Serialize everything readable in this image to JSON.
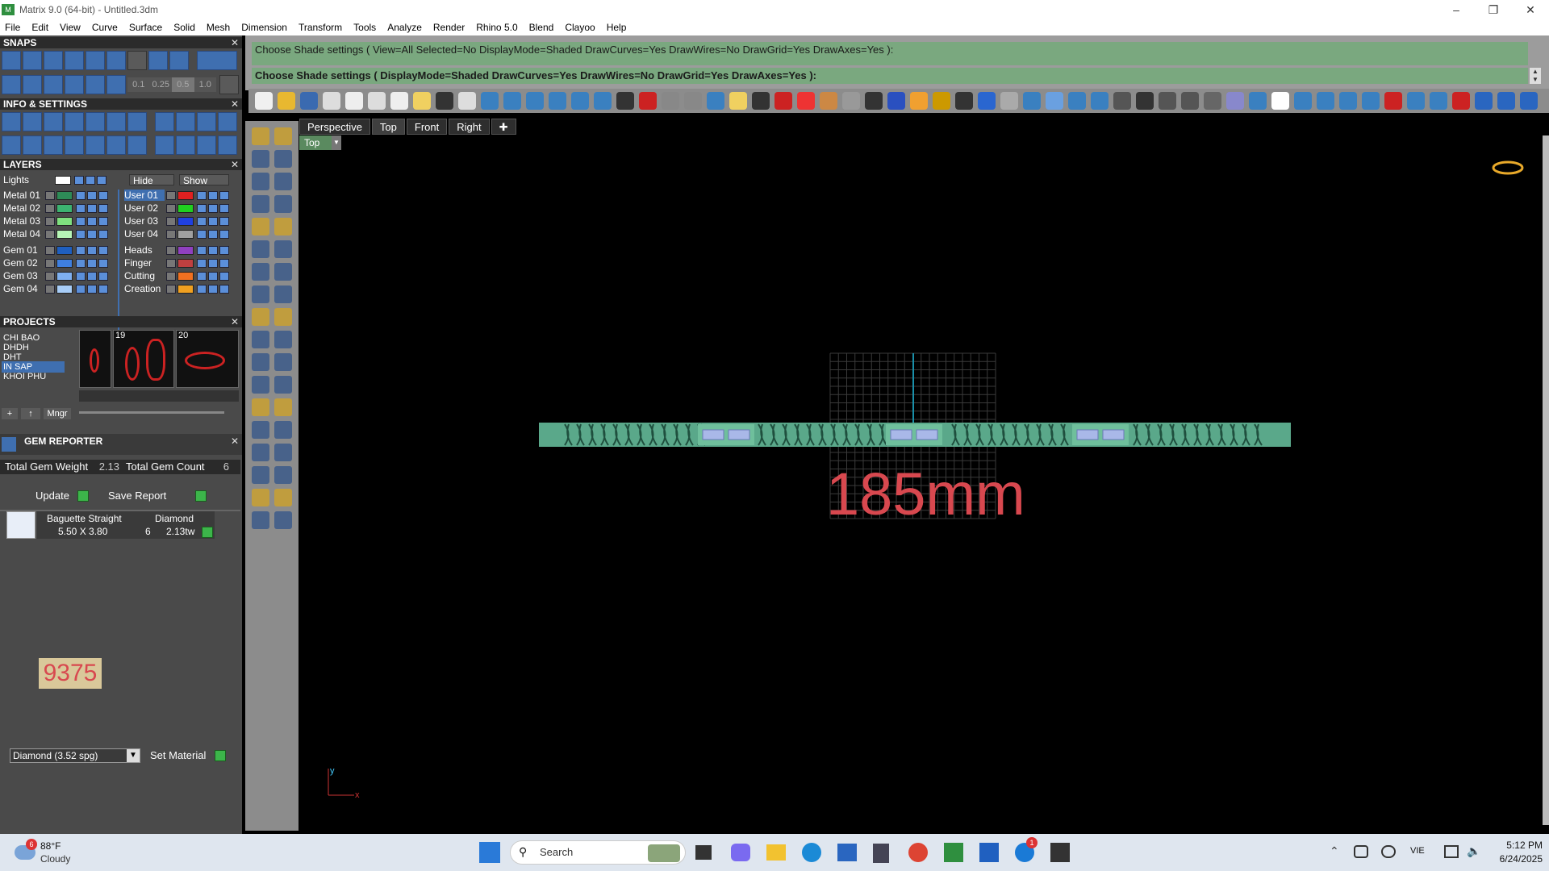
{
  "window": {
    "title": "Matrix 9.0 (64-bit) - Untitled.3dm",
    "app_icon": "matrix-logo-icon"
  },
  "menu": [
    "File",
    "Edit",
    "View",
    "Curve",
    "Surface",
    "Solid",
    "Mesh",
    "Dimension",
    "Transform",
    "Tools",
    "Analyze",
    "Render",
    "Rhino 5.0",
    "Blend",
    "Clayoo",
    "Help"
  ],
  "panels": {
    "snaps": {
      "title": "SNAPS",
      "values": [
        "0.1",
        "0.25",
        "0.5",
        "1.0"
      ]
    },
    "info": {
      "title": "INFO & SETTINGS"
    },
    "layers": {
      "title": "LAYERS",
      "lights_label": "Lights",
      "hide_label": "Hide",
      "show_label": "Show",
      "left": [
        {
          "name": "Metal 01",
          "color": "#2e8b57"
        },
        {
          "name": "Metal 02",
          "color": "#3cb371"
        },
        {
          "name": "Metal 03",
          "color": "#7fe07f"
        },
        {
          "name": "Metal 04",
          "color": "#b6f5b6"
        },
        {
          "name": "Gem 01",
          "color": "#1f5fbf"
        },
        {
          "name": "Gem 02",
          "color": "#3f7fdf"
        },
        {
          "name": "Gem 03",
          "color": "#7fb0f0"
        },
        {
          "name": "Gem 04",
          "color": "#a8cdf7"
        }
      ],
      "right": [
        {
          "name": "User 01",
          "color": "#e02020",
          "selected": true
        },
        {
          "name": "User 02",
          "color": "#20d020"
        },
        {
          "name": "User 03",
          "color": "#2040e0"
        },
        {
          "name": "User 04",
          "color": "#a0a0a0"
        },
        {
          "name": "Heads",
          "color": "#9040c0"
        },
        {
          "name": "Finger",
          "color": "#c04040"
        },
        {
          "name": "Cutting",
          "color": "#f07020"
        },
        {
          "name": "Creation",
          "color": "#f0a020"
        }
      ]
    },
    "projects": {
      "title": "PROJECTS",
      "items": [
        "CHI BAO",
        "DHDH",
        "DHT",
        "IN SAP",
        "KHOI PHU"
      ],
      "selected": "IN SAP",
      "thumb_numbers": [
        "19",
        "20"
      ],
      "mngr_label": "Mngr"
    },
    "gem_reporter": {
      "title": "GEM REPORTER",
      "total_weight_label": "Total Gem Weight",
      "total_weight": "2.13",
      "total_count_label": "Total Gem Count",
      "total_count": "6",
      "update_label": "Update",
      "save_label": "Save Report",
      "row": {
        "shape": "Baguette Straight",
        "material": "Diamond",
        "size": "5.50 X 3.80",
        "count": "6",
        "weight": "2.13tw"
      },
      "sticker": "9375",
      "material_select": "Diamond     (3.52 spg)",
      "set_material_label": "Set Material"
    }
  },
  "command": {
    "line1": "Choose Shade settings ( View=All  Selected=No  DisplayMode=Shaded  DrawCurves=Yes  DrawWires=No  DrawGrid=Yes  DrawAxes=Yes ):",
    "line2": "Choose Shade settings ( DisplayMode=Shaded  DrawCurves=Yes  DrawWires=No  DrawGrid=Yes  DrawAxes=Yes ):"
  },
  "viewport": {
    "tabs": [
      "Perspective",
      "Top",
      "Front",
      "Right"
    ],
    "active_tab": "Top",
    "label": "Top",
    "dimension_text": "185mm",
    "axis_y": "y",
    "axis_x": "x"
  },
  "taskbar": {
    "weather_temp": "88°F",
    "weather_desc": "Cloudy",
    "weather_badge": "6",
    "search_placeholder": "Search",
    "lang": "VIE",
    "time": "5:12 PM",
    "date": "6/24/2025",
    "zalo_badge": "1"
  },
  "colors": {
    "panel_bg": "#4a4a4a",
    "command_bg": "#7aa87f",
    "bracelet": "#5aa88a",
    "dimension": "#d8484f"
  }
}
